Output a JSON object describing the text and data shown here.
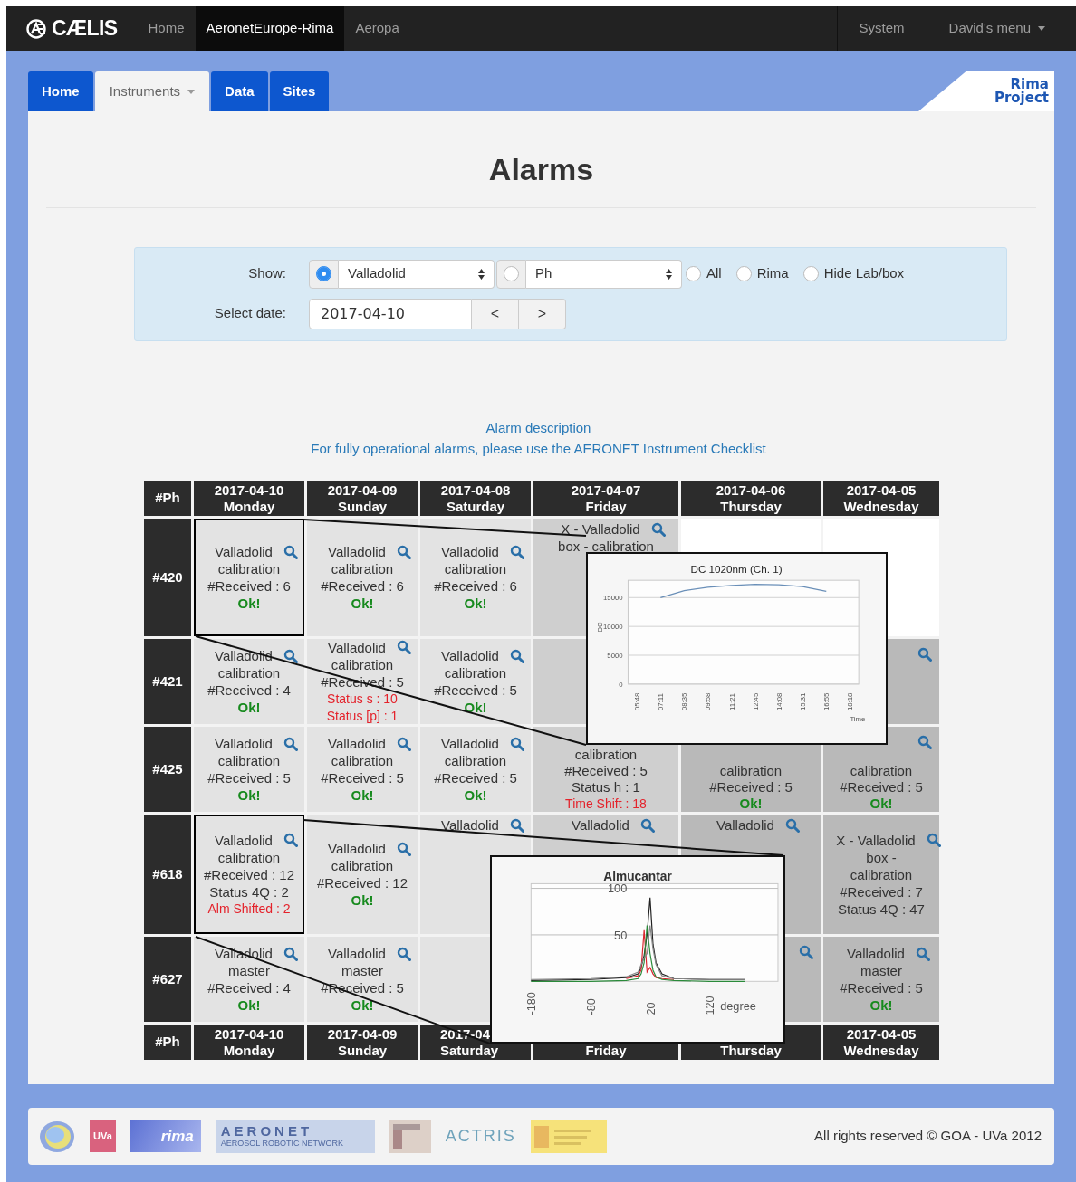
{
  "navbar": {
    "logo": "CÆLIS",
    "items": [
      {
        "label": "Home",
        "selected": false
      },
      {
        "label": "AeronetEurope-Rima",
        "selected": true
      },
      {
        "label": "Aeropa",
        "selected": false
      }
    ],
    "right_items": [
      {
        "label": "System",
        "dropdown": false
      },
      {
        "label": "David's menu",
        "dropdown": true
      }
    ]
  },
  "tabs": [
    {
      "label": "Home",
      "selected": false,
      "dropdown": false
    },
    {
      "label": "Instruments",
      "selected": true,
      "dropdown": true
    },
    {
      "label": "Data",
      "selected": false,
      "dropdown": false
    },
    {
      "label": "Sites",
      "selected": false,
      "dropdown": false
    }
  ],
  "project_logo": [
    "Rima",
    "Project"
  ],
  "title": "Alarms",
  "filters": {
    "show_label": "Show:",
    "selects": [
      {
        "value": "Valladolid",
        "checked": true
      },
      {
        "value": "Ph",
        "checked": false
      }
    ],
    "radios": [
      {
        "label": "All",
        "checked": false
      },
      {
        "label": "Rima",
        "checked": false
      },
      {
        "label": "Hide Lab/box",
        "checked": false
      }
    ],
    "date_label": "Select date:",
    "date": "2017-04-10",
    "prev": "<",
    "next": ">"
  },
  "links": [
    "Alarm description",
    "For fully operational alarms, please use the AERONET Instrument Checklist"
  ],
  "table": {
    "corner": "#Ph",
    "columns": [
      {
        "date": "2017-04-10",
        "day": "Monday"
      },
      {
        "date": "2017-04-09",
        "day": "Sunday"
      },
      {
        "date": "2017-04-08",
        "day": "Saturday"
      },
      {
        "date": "2017-04-07",
        "day": "Friday"
      },
      {
        "date": "2017-04-06",
        "day": "Thursday"
      },
      {
        "date": "2017-04-05",
        "day": "Wednesday"
      }
    ],
    "rows": [
      {
        "instrument": "#420",
        "cells": [
          {
            "kind": "light",
            "search": true,
            "highlighted": true,
            "lines": [
              {
                "text": "Valladolid",
                "kind": "plain"
              },
              {
                "text": "calibration",
                "kind": "plain"
              },
              {
                "text": "#Received : 6",
                "kind": "plain"
              },
              {
                "text": "Ok!",
                "kind": "ok"
              }
            ]
          },
          {
            "kind": "light",
            "search": true,
            "highlighted": false,
            "lines": [
              {
                "text": "Valladolid",
                "kind": "plain"
              },
              {
                "text": "calibration",
                "kind": "plain"
              },
              {
                "text": "#Received : 6",
                "kind": "plain"
              },
              {
                "text": "Ok!",
                "kind": "ok"
              }
            ]
          },
          {
            "kind": "light",
            "search": true,
            "highlighted": false,
            "lines": [
              {
                "text": "Valladolid",
                "kind": "plain"
              },
              {
                "text": "calibration",
                "kind": "plain"
              },
              {
                "text": "#Received : 6",
                "kind": "plain"
              },
              {
                "text": "Ok!",
                "kind": "ok"
              }
            ]
          },
          {
            "kind": "medium",
            "search": true,
            "highlighted": false,
            "lines": [
              {
                "text": "X - Valladolid",
                "kind": "plain"
              },
              {
                "text": "box - calibration",
                "kind": "plain"
              }
            ]
          },
          {
            "kind": "empty",
            "search": false,
            "highlighted": false
          },
          {
            "kind": "empty",
            "search": false,
            "highlighted": false
          }
        ]
      },
      {
        "instrument": "#421",
        "cells": [
          {
            "kind": "light",
            "search": true,
            "highlighted": false,
            "lines": [
              {
                "text": "Valladolid",
                "kind": "plain"
              },
              {
                "text": "calibration",
                "kind": "plain"
              },
              {
                "text": "#Received : 4",
                "kind": "plain"
              },
              {
                "text": "Ok!",
                "kind": "ok"
              }
            ]
          },
          {
            "kind": "light",
            "search": true,
            "highlighted": false,
            "lines": [
              {
                "text": "Valladolid",
                "kind": "plain"
              },
              {
                "text": "calibration",
                "kind": "plain"
              },
              {
                "text": "#Received : 5",
                "kind": "plain"
              },
              {
                "text": "Status s : 10",
                "kind": "alarm"
              },
              {
                "text": "Status [p] : 1",
                "kind": "alarm"
              }
            ]
          },
          {
            "kind": "light",
            "search": true,
            "highlighted": false,
            "lines": [
              {
                "text": "Valladolid",
                "kind": "plain"
              },
              {
                "text": "calibration",
                "kind": "plain"
              },
              {
                "text": "#Received : 5",
                "kind": "plain"
              },
              {
                "text": "Ok!",
                "kind": "ok"
              }
            ]
          },
          {
            "kind": "medium",
            "search": false,
            "highlighted": false
          },
          null,
          {
            "kind": "dark",
            "search": true,
            "highlighted": false
          }
        ]
      },
      {
        "instrument": "#425",
        "cells": [
          {
            "kind": "light",
            "search": true,
            "highlighted": false,
            "lines": [
              {
                "text": "Valladolid",
                "kind": "plain"
              },
              {
                "text": "calibration",
                "kind": "plain"
              },
              {
                "text": "#Received : 5",
                "kind": "plain"
              },
              {
                "text": "Ok!",
                "kind": "ok"
              }
            ]
          },
          {
            "kind": "light",
            "search": true,
            "highlighted": false,
            "lines": [
              {
                "text": "Valladolid",
                "kind": "plain"
              },
              {
                "text": "calibration",
                "kind": "plain"
              },
              {
                "text": "#Received : 5",
                "kind": "plain"
              },
              {
                "text": "Ok!",
                "kind": "ok"
              }
            ]
          },
          {
            "kind": "light",
            "search": true,
            "highlighted": false,
            "lines": [
              {
                "text": "Valladolid",
                "kind": "plain"
              },
              {
                "text": "calibration",
                "kind": "plain"
              },
              {
                "text": "#Received : 5",
                "kind": "plain"
              },
              {
                "text": "Ok!",
                "kind": "ok"
              }
            ]
          },
          {
            "kind": "medium",
            "search": false,
            "highlighted": false,
            "lines": [
              {
                "text": "calibration",
                "kind": "plain"
              },
              {
                "text": "#Received : 5",
                "kind": "plain"
              },
              {
                "text": "Status h : 1",
                "kind": "plain"
              },
              {
                "text": "Time Shift : 18",
                "kind": "alarm"
              }
            ]
          },
          {
            "kind": "dark",
            "search": false,
            "highlighted": false,
            "lines": [
              {
                "text": "calibration",
                "kind": "plain"
              },
              {
                "text": "#Received : 5",
                "kind": "plain"
              },
              {
                "text": "Ok!",
                "kind": "ok"
              }
            ]
          },
          {
            "kind": "dark",
            "search": true,
            "highlighted": false,
            "lines": [
              {
                "text": "calibration",
                "kind": "plain"
              },
              {
                "text": "#Received : 5",
                "kind": "plain"
              },
              {
                "text": "Ok!",
                "kind": "ok"
              }
            ]
          }
        ]
      },
      {
        "instrument": "#618",
        "cells": [
          {
            "kind": "light",
            "search": true,
            "highlighted": true,
            "lines": [
              {
                "text": "Valladolid",
                "kind": "plain"
              },
              {
                "text": "calibration",
                "kind": "plain"
              },
              {
                "text": "#Received : 12",
                "kind": "plain"
              },
              {
                "text": "Status 4Q : 2",
                "kind": "plain"
              },
              {
                "text": "Alm Shifted : 2",
                "kind": "alarm"
              }
            ]
          },
          {
            "kind": "light",
            "search": true,
            "highlighted": false,
            "lines": [
              {
                "text": "Valladolid",
                "kind": "plain"
              },
              {
                "text": "calibration",
                "kind": "plain"
              },
              {
                "text": "#Received : 12",
                "kind": "plain"
              },
              {
                "text": "Ok!",
                "kind": "ok"
              }
            ]
          },
          {
            "kind": "light",
            "search": true,
            "highlighted": false,
            "lines": [
              {
                "text": "Valladolid",
                "kind": "plain"
              }
            ]
          },
          {
            "kind": "medium",
            "search": true,
            "highlighted": false,
            "lines": [
              {
                "text": "Valladolid",
                "kind": "plain"
              }
            ]
          },
          {
            "kind": "dark",
            "search": true,
            "highlighted": false,
            "lines": [
              {
                "text": "Valladolid",
                "kind": "plain"
              }
            ]
          },
          {
            "kind": "dark",
            "search": true,
            "highlighted": false,
            "lines": [
              {
                "text": "X - Valladolid",
                "kind": "plain"
              },
              {
                "text": "box -",
                "kind": "plain"
              },
              {
                "text": "calibration",
                "kind": "plain"
              },
              {
                "text": "#Received : 7",
                "kind": "plain"
              },
              {
                "text": "Status 4Q : 47",
                "kind": "plain"
              }
            ]
          }
        ]
      },
      {
        "instrument": "#627",
        "cells": [
          {
            "kind": "light",
            "search": true,
            "highlighted": false,
            "lines": [
              {
                "text": "Valladolid",
                "kind": "plain"
              },
              {
                "text": "master",
                "kind": "plain"
              },
              {
                "text": "#Received : 4",
                "kind": "plain"
              },
              {
                "text": "Ok!",
                "kind": "ok"
              }
            ]
          },
          {
            "kind": "light",
            "search": true,
            "highlighted": false,
            "lines": [
              {
                "text": "Valladolid",
                "kind": "plain"
              },
              {
                "text": "master",
                "kind": "plain"
              },
              {
                "text": "#Received : 5",
                "kind": "plain"
              },
              {
                "text": "Ok!",
                "kind": "ok"
              }
            ]
          },
          {
            "kind": "light",
            "search": false,
            "highlighted": false
          },
          null,
          {
            "kind": "dark",
            "search": true,
            "highlighted": false
          },
          {
            "kind": "dark",
            "search": true,
            "highlighted": false,
            "lines": [
              {
                "text": "Valladolid",
                "kind": "plain"
              },
              {
                "text": "master",
                "kind": "plain"
              },
              {
                "text": "#Received : 5",
                "kind": "plain"
              },
              {
                "text": "Ok!",
                "kind": "ok"
              }
            ]
          }
        ]
      }
    ],
    "footer_corner": "#Ph",
    "footer_columns": [
      {
        "date": "2017-04-10",
        "day": "Monday"
      },
      {
        "date": "2017-04-09",
        "day": "Sunday"
      },
      {
        "date": "2017-04",
        "day": "Saturday"
      },
      {
        "day": "Friday"
      },
      {
        "day": "Thursday"
      },
      {
        "date": "2017-04-05",
        "day": "Wednesday"
      }
    ]
  },
  "popups": [
    {
      "chart_data": {
        "type": "line",
        "title": "DC 1020nm (Ch. 1)",
        "xlabel": "Time",
        "ylabel": "DC",
        "categories": [
          "05:48",
          "07:11",
          "08:35",
          "09:58",
          "11:21",
          "12:45",
          "14:08",
          "15:31",
          "16:55",
          "18:18"
        ],
        "series": [
          {
            "color": "#6a8fb8",
            "values": [
              null,
              15000,
              16200,
              16800,
              17100,
              17300,
              17200,
              16900,
              16100,
              null
            ]
          }
        ],
        "ylim": [
          0,
          18000
        ],
        "yticks": [
          0,
          5000,
          10000,
          15000
        ],
        "grid": true
      }
    },
    {
      "chart_data": {
        "type": "line",
        "title": "Almucantar",
        "xlabel": "degree",
        "x": [
          -180,
          -80,
          -20,
          0,
          5,
          10,
          15,
          20,
          25,
          30,
          40,
          60,
          120,
          180
        ],
        "series": [
          {
            "color": "#222222",
            "values": [
              1,
              2,
              4,
              8,
              15,
              28,
              50,
              90,
              40,
              20,
              8,
              3,
              2,
              2
            ]
          },
          {
            "color": "#d9262e",
            "values": [
              null,
              null,
              3,
              6,
              12,
              55,
              10,
              15,
              8,
              4,
              3,
              2,
              null,
              null
            ]
          },
          {
            "color": "#2a8a3a",
            "values": [
              0,
              0,
              1,
              3,
              8,
              20,
              60,
              30,
              12,
              5,
              2,
              1,
              0,
              0
            ]
          },
          {
            "color": "#888888",
            "values": [
              2,
              3,
              5,
              10,
              18,
              25,
              30,
              60,
              35,
              18,
              6,
              3,
              2,
              2
            ]
          }
        ],
        "xlim": [
          -180,
          235
        ],
        "ylim": [
          0,
          105
        ],
        "xticks": [
          -180,
          -80,
          20,
          120
        ],
        "yticks": [
          50,
          100
        ],
        "grid": true
      }
    }
  ],
  "footer": {
    "logos": [
      "UVa",
      "rima",
      "AERONET",
      "AEROSOL ROBOTIC NETWORK",
      "ACTRIS"
    ],
    "copyright": "All rights reserved © GOA - UVa 2012"
  }
}
